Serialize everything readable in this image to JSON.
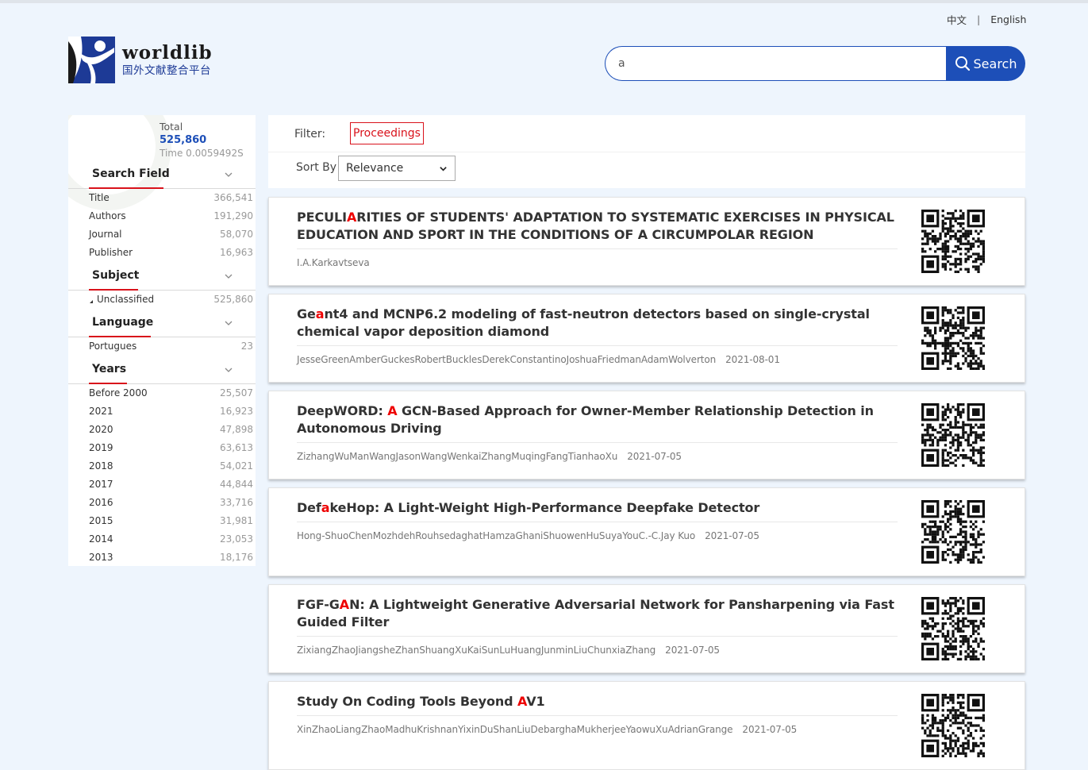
{
  "header": {
    "lang_zh": "中文",
    "lang_sep": "|",
    "lang_en": "English",
    "logo_name": "worldlib",
    "logo_sub": "国外文献整合平台"
  },
  "search": {
    "value": "a",
    "button_label": "Search",
    "icon": "search-icon"
  },
  "sidebar": {
    "total_label": "Total",
    "total_value": "525,860",
    "time_label": "Time 0.0059492S",
    "facets": [
      {
        "title": "Search Field",
        "rows": [
          {
            "name": "Title",
            "count": "366,541"
          },
          {
            "name": "Authors",
            "count": "191,290"
          },
          {
            "name": "Journal",
            "count": "58,070"
          },
          {
            "name": "Publisher",
            "count": "16,963"
          }
        ]
      },
      {
        "title": "Subject",
        "rows": [
          {
            "name": "Unclassified",
            "count": "525,860"
          }
        ]
      },
      {
        "title": "Language",
        "rows": [
          {
            "name": "Portugues",
            "count": "23"
          }
        ]
      },
      {
        "title": "Years",
        "rows": [
          {
            "name": "Before 2000",
            "count": "25,507"
          },
          {
            "name": "2021",
            "count": "16,923"
          },
          {
            "name": "2020",
            "count": "47,898"
          },
          {
            "name": "2019",
            "count": "63,613"
          },
          {
            "name": "2018",
            "count": "54,021"
          },
          {
            "name": "2017",
            "count": "44,844"
          },
          {
            "name": "2016",
            "count": "33,716"
          },
          {
            "name": "2015",
            "count": "31,981"
          },
          {
            "name": "2014",
            "count": "23,053"
          },
          {
            "name": "2013",
            "count": "18,176"
          }
        ]
      }
    ]
  },
  "filter": {
    "label": "Filter:",
    "chip": "Proceedings",
    "sort_label": "Sort By",
    "sort_value": "Relevance"
  },
  "results": [
    {
      "title": [
        "PECULI",
        "A",
        "RITIES OF STUDENTS' ADAPTATION TO SYSTEMATIC EXERCISES IN PHYSICAL EDUCATION AND SPORT IN THE CONDITIONS OF A CIRCUMPOLAR REGION"
      ],
      "authors": "I.A.Karkavtseva",
      "date": ""
    },
    {
      "title": [
        "Ge",
        "a",
        "nt4 and MCNP6.2 modeling of fast-neutron detectors based on single-crystal chemical vapor deposition diamond"
      ],
      "authors": "JesseGreenAmberGuckesRobertBucklesDerekConstantinoJoshuaFriedmanAdamWolverton",
      "date": "2021-08-01"
    },
    {
      "title": [
        "DeepWORD: ",
        "A",
        " GCN-Based Approach for Owner-Member Relationship Detection in Autonomous Driving"
      ],
      "authors": "ZizhangWuManWangJasonWangWenkaiZhangMuqingFangTianhaoXu",
      "date": "2021-07-05"
    },
    {
      "title": [
        "Def",
        "a",
        "keHop: A Light-Weight High-Performance Deepfake Detector"
      ],
      "authors": "Hong-ShuoChenMozhdehRouhsedaghatHamzaGhaniShuowenHuSuyaYouC.-C.Jay Kuo",
      "date": "2021-07-05"
    },
    {
      "title": [
        "FGF-G",
        "A",
        "N: A Lightweight Generative Adversarial Network for Pansharpening via Fast Guided Filter"
      ],
      "authors": "ZixiangZhaoJiangsheZhanShuangXuKaiSunLuHuangJunminLiuChunxiaZhang",
      "date": "2021-07-05"
    },
    {
      "title": [
        "Study On Coding Tools Beyond ",
        "A",
        "V1"
      ],
      "authors": "XinZhaoLiangZhaoMadhuKrishnanYixinDuShanLiuDebarghaMukherjeeYaowuXuAdrianGrange",
      "date": "2021-07-05"
    }
  ],
  "colors": {
    "accent": "#1d4fb8",
    "highlight": "#d9121b",
    "background": "#eef5fd"
  }
}
